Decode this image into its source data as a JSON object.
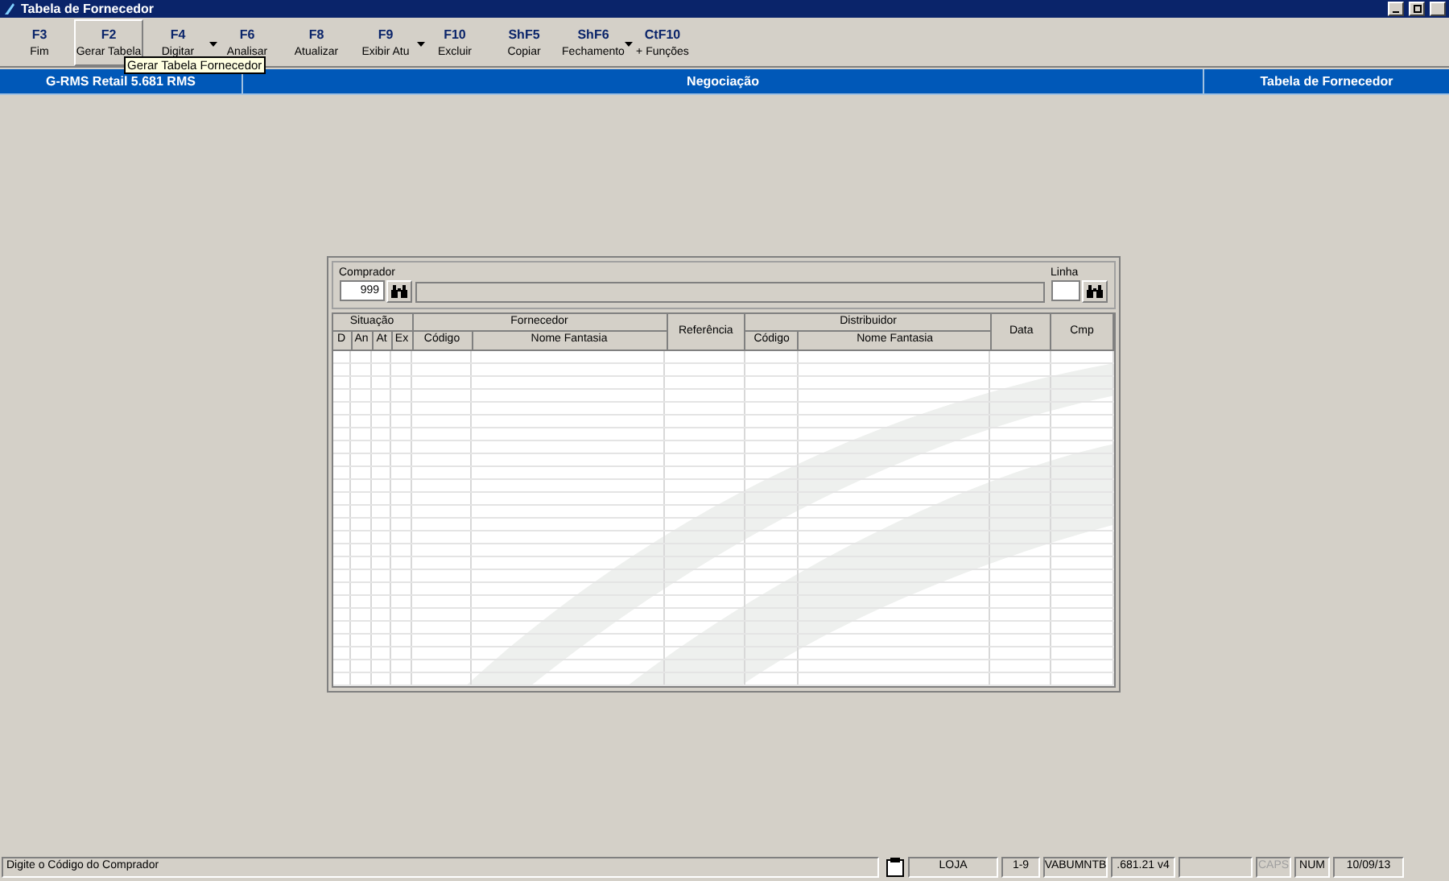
{
  "window": {
    "title": "Tabela de Fornecedor"
  },
  "toolbar": [
    {
      "key": "F3",
      "label": "Fim",
      "selected": false,
      "dropdown": false
    },
    {
      "key": "F2",
      "label": "Gerar Tabela",
      "selected": true,
      "dropdown": false
    },
    {
      "key": "F4",
      "label": "Digitar",
      "selected": false,
      "dropdown": true
    },
    {
      "key": "F6",
      "label": "Analisar",
      "selected": false,
      "dropdown": false
    },
    {
      "key": "F8",
      "label": "Atualizar",
      "selected": false,
      "dropdown": false
    },
    {
      "key": "F9",
      "label": "Exibir Atu",
      "selected": false,
      "dropdown": true
    },
    {
      "key": "F10",
      "label": "Excluir",
      "selected": false,
      "dropdown": false
    },
    {
      "key": "ShF5",
      "label": "Copiar",
      "selected": false,
      "dropdown": false
    },
    {
      "key": "ShF6",
      "label": "Fechamento",
      "selected": false,
      "dropdown": true
    },
    {
      "key": "CtF10",
      "label": "+ Funções",
      "selected": false,
      "dropdown": false
    }
  ],
  "tooltip": "Gerar Tabela Fornecedor",
  "header_band": [
    "G-RMS Retail 5.681 RMS",
    "Negociação",
    "Tabela de Fornecedor"
  ],
  "form": {
    "comprador_label": "Comprador",
    "comprador_value": "999",
    "linha_label": "Linha"
  },
  "table": {
    "groups": [
      {
        "label": "Situação",
        "columns": [
          "D",
          "An",
          "At",
          "Ex"
        ]
      },
      {
        "label": "Fornecedor",
        "columns": [
          "Código",
          "Nome Fantasia"
        ]
      },
      {
        "label": "Referência"
      },
      {
        "label": "Distribuidor",
        "columns": [
          "Código",
          "Nome Fantasia"
        ]
      },
      {
        "label": "Data"
      },
      {
        "label": "Cmp"
      }
    ]
  },
  "status_bar": {
    "message": "Digite o Código do Comprador",
    "fields": [
      {
        "text": "LOJA",
        "disabled": false
      },
      {
        "text": "1-9",
        "disabled": false
      },
      {
        "text": "VABUMNTB",
        "disabled": false
      },
      {
        "text": ".681.21 v4",
        "disabled": false
      },
      {
        "text": "CAPS",
        "disabled": true
      },
      {
        "text": "NUM",
        "disabled": false
      },
      {
        "text": "10/09/13",
        "disabled": false
      }
    ]
  }
}
